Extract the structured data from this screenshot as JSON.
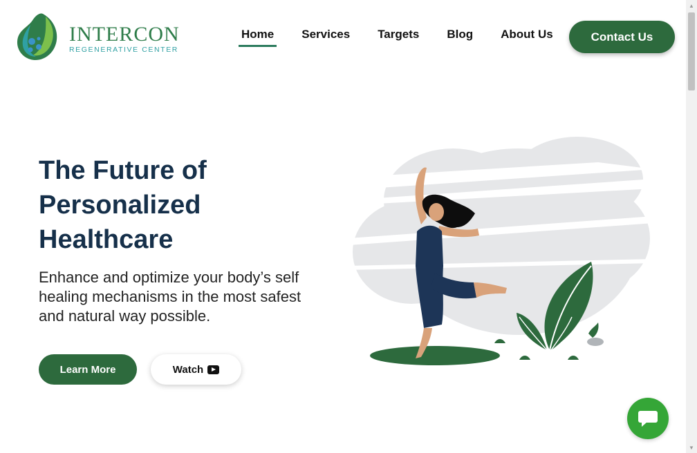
{
  "brand": {
    "name": "INTERCON",
    "tagline": "REGENERATIVE CENTER",
    "logo_icon": "leaf-drop-logo-icon",
    "colors": {
      "primary_green": "#2d6a3d",
      "logo_green": "#2f7d4a",
      "teal": "#2fa0a3",
      "heading_navy": "#16304a",
      "chat_green": "#35a637"
    }
  },
  "nav": {
    "items": [
      {
        "label": "Home",
        "active": true
      },
      {
        "label": "Services",
        "active": false
      },
      {
        "label": "Targets",
        "active": false
      },
      {
        "label": "Blog",
        "active": false
      },
      {
        "label": "About Us",
        "active": false
      }
    ],
    "contact_label": "Contact Us"
  },
  "hero": {
    "title_lines": [
      "The Future of",
      "Personalized",
      "Healthcare"
    ],
    "subtitle_lines": [
      "Enhance and optimize your body’s self",
      "healing mechanisms in the most safest",
      "and natural way possible."
    ],
    "learn_more_label": "Learn More",
    "watch_label": "Watch",
    "watch_icon": "youtube-play-icon",
    "illustration": "dancing-woman-with-plants-illustration"
  },
  "chat": {
    "icon": "chat-bubble-icon"
  }
}
